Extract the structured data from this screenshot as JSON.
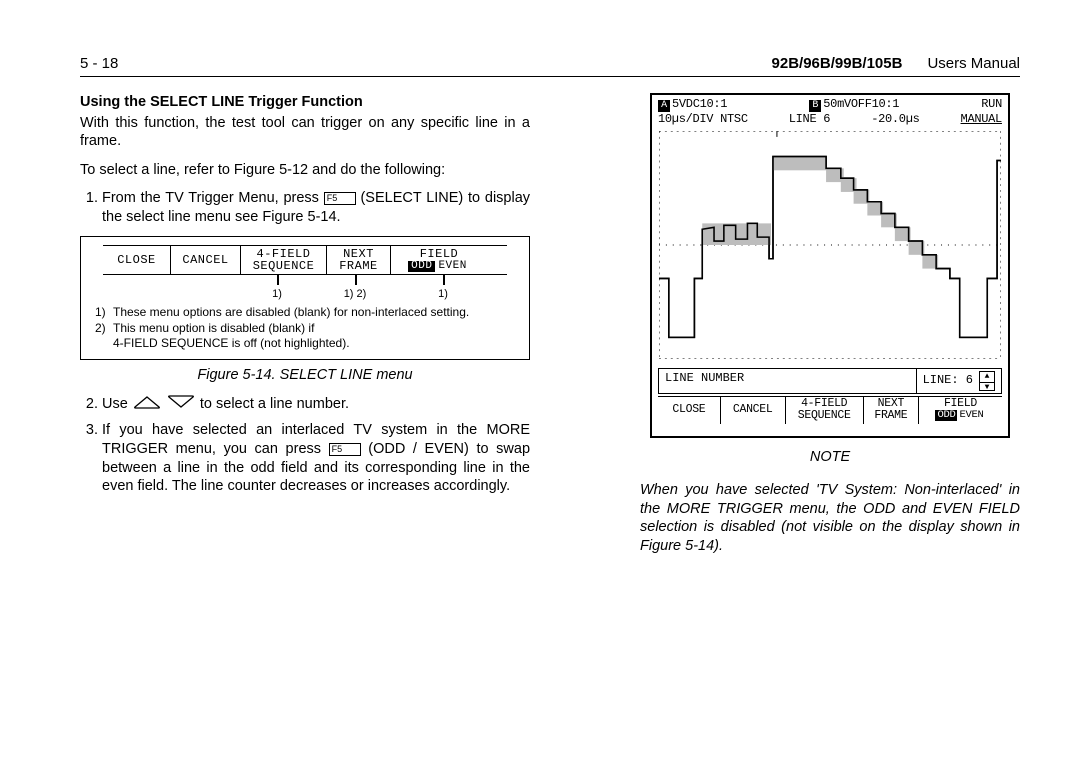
{
  "header": {
    "page": "5 - 18",
    "model": "92B/96B/99B/105B",
    "manual": "Users Manual"
  },
  "section_title": "Using the SELECT LINE Trigger Function",
  "intro": "With this function, the test tool can trigger on any specific line in a frame.",
  "intro2": "To select a line, refer to Figure 5-12 and do the following:",
  "steps": {
    "s1a": "From the TV Trigger Menu, press",
    "s1_key": "F5",
    "s1b": "(SELECT LINE) to display the select line menu see Figure 5-14.",
    "s2a": "Use",
    "s2b": "to select a line number.",
    "s3a": "If you have selected an interlaced TV system in the MORE TRIGGER menu, you can press",
    "s3_key": "F5",
    "s3b": "(ODD / EVEN) to swap between a line in the odd field and its corresponding line in the even field. The line counter decreases or increases accordingly."
  },
  "fig14": {
    "menu": {
      "c1": "CLOSE",
      "c2": "CANCEL",
      "c3a": "4-FIELD",
      "c3b": "SEQUENCE",
      "c4a": "NEXT",
      "c4b": "FRAME",
      "c5a": "FIELD",
      "c5_odd": "ODD",
      "c5_even": "EVEN"
    },
    "ticks": {
      "t1": "1)",
      "t2": "1) 2)",
      "t3": "1)"
    },
    "note1": "These menu options are disabled (blank) for non-interlaced setting.",
    "note2a": "This menu option is disabled (blank) if",
    "note2b": "4-FIELD SEQUENCE is off (not highlighted).",
    "caption": "Figure 5-14.   SELECT LINE menu"
  },
  "scope": {
    "head": {
      "a": "5VDC10:1",
      "b": "50mVOFF10:1",
      "run": "RUN",
      "div": "10µs/DIV NTSC",
      "line": "LINE 6",
      "delay": "-20.0µs",
      "manual": "MANUAL"
    },
    "line_row": {
      "label": "LINE NUMBER",
      "value": "LINE: 6"
    },
    "menu": {
      "d1": "CLOSE",
      "d2": "CANCEL",
      "d3a": "4-FIELD",
      "d3b": "SEQUENCE",
      "d4a": "NEXT",
      "d4b": "FRAME",
      "d5a": "FIELD",
      "d5_odd": "ODD",
      "d5_even": "EVEN"
    }
  },
  "note": {
    "label": "NOTE",
    "body": "When you have selected 'TV System: Non-interlaced' in the MORE TRIGGER menu, the ODD and EVEN FIELD selection is disabled (not visible on the display shown in Figure 5-14)."
  }
}
